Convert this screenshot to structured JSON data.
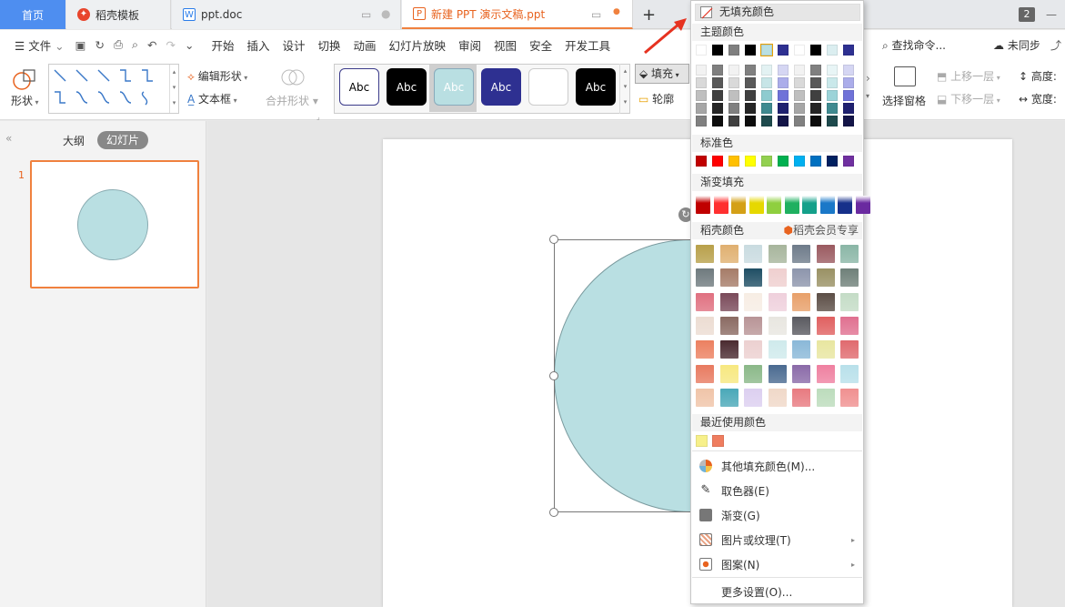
{
  "tabs": [
    {
      "label": "首页"
    },
    {
      "label": "稻壳模板"
    },
    {
      "label": "ppt.doc"
    },
    {
      "label": "新建 PPT 演示文稿.ppt"
    }
  ],
  "window": {
    "badge": "2"
  },
  "menu": [
    "开始",
    "插入",
    "设计",
    "切换",
    "动画",
    "幻灯片放映",
    "审阅",
    "视图",
    "安全",
    "开发工具"
  ],
  "file_label": "文件",
  "search": "查找命令...",
  "sync": "未同步",
  "ribbon": {
    "shape_label": "形状",
    "edit_shape": "编辑形状",
    "text_box": "文本框",
    "merge_shape": "合并形状",
    "abc": [
      "Abc",
      "Abc",
      "Abc",
      "Abc",
      "",
      "Abc"
    ],
    "fill": "填充",
    "outline": "轮廓",
    "select_pane": "选择窗格",
    "move_up": "上移一层",
    "move_down": "下移一层",
    "height": "高度:",
    "width": "宽度:"
  },
  "panel": {
    "outline": "大纲",
    "slides": "幻灯片",
    "slide_num": "1"
  },
  "dropdown": {
    "no_fill": "无填充颜色",
    "theme_title": "主题颜色",
    "standard_title": "标准色",
    "gradient_title": "渐变填充",
    "daoke_title": "稻壳颜色",
    "member": "稻壳会员专享",
    "recent_title": "最近使用颜色",
    "more_colors": "其他填充颜色(M)...",
    "eyedropper": "取色器(E)",
    "gradient": "渐变(G)",
    "picture": "图片或纹理(T)",
    "pattern": "图案(N)",
    "more_settings": "更多设置(O)..."
  },
  "colors": {
    "accent": "#f0813e",
    "home_tab": "#4e8ef0",
    "shape_fill": "#b9dfe2",
    "standard": [
      "#c00000",
      "#ff0000",
      "#ffc000",
      "#ffff00",
      "#92d050",
      "#00b050",
      "#00b0f0",
      "#0070c0",
      "#002060",
      "#7030a0"
    ],
    "recent": [
      "#f7f08a",
      "#ef7d5f"
    ]
  }
}
